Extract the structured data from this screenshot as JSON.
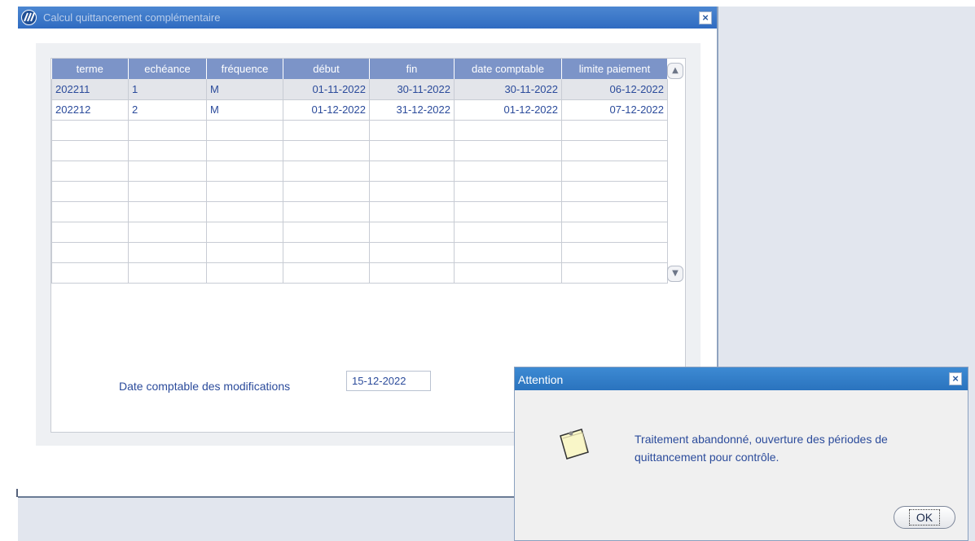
{
  "window": {
    "title": "Calcul quittancement complémentaire",
    "close_label": "×"
  },
  "table": {
    "columns": [
      "terme",
      "echéance",
      "fréquence",
      "début",
      "fin",
      "date comptable",
      "limite paiement"
    ],
    "rows": [
      [
        "202211",
        "1",
        "M",
        "01-11-2022",
        "30-11-2022",
        "30-11-2022",
        "06-12-2022"
      ],
      [
        "202212",
        "2",
        "M",
        "01-12-2022",
        "31-12-2022",
        "01-12-2022",
        "07-12-2022"
      ]
    ],
    "scroll_up_label": "▲",
    "scroll_down_label": "▼"
  },
  "form": {
    "date_label": "Date comptable des modifications",
    "date_value": "15-12-2022"
  },
  "dialog": {
    "title": "Attention",
    "close_label": "×",
    "message": "Traitement abandonné, ouverture des périodes de quittancement pour contrôle.",
    "ok_label": "OK",
    "icon": "note-icon"
  },
  "colors": {
    "title_bar": "#2f6bc1",
    "header": "#7c94c8",
    "text": "#2b4b9b"
  }
}
